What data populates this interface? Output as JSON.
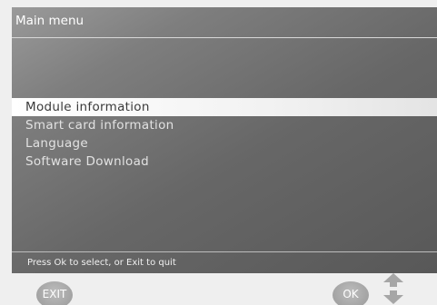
{
  "panel": {
    "title": "Main menu"
  },
  "menu": {
    "items": [
      {
        "label": "Module information",
        "selected": true
      },
      {
        "label": "Smart card information",
        "selected": false
      },
      {
        "label": "Language",
        "selected": false
      },
      {
        "label": "Software Download",
        "selected": false
      }
    ]
  },
  "status": {
    "hint": "Press Ok to select, or Exit to quit"
  },
  "softkeys": {
    "exit_label": "EXIT",
    "ok_label": "OK"
  },
  "colors": {
    "panel_dark": "#585858",
    "panel_light": "#9a9a9a",
    "highlight": "#ffffff",
    "key": "#a3a3a3"
  },
  "icons": {
    "navigation": "up-down-arrows-icon"
  }
}
